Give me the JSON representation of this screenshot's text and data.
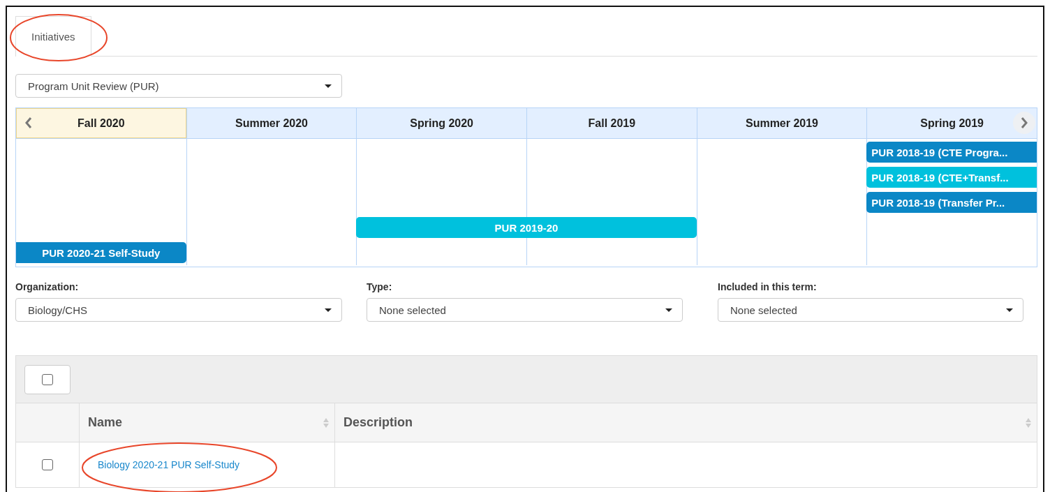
{
  "tabs": [
    {
      "label": "Initiatives",
      "selected": true
    }
  ],
  "program_select": {
    "value": "Program Unit Review (PUR)"
  },
  "timeline": {
    "terms": [
      {
        "label": "Fall 2020",
        "selected": true
      },
      {
        "label": "Summer 2020",
        "selected": false
      },
      {
        "label": "Spring 2020",
        "selected": false
      },
      {
        "label": "Fall 2019",
        "selected": false
      },
      {
        "label": "Summer 2019",
        "selected": false
      },
      {
        "label": "Spring 2019",
        "selected": false
      }
    ],
    "events": [
      {
        "label": "PUR 2020-21 Self-Study",
        "color": "#0b87c6"
      },
      {
        "label": "PUR 2019-20",
        "color": "#00c1dd"
      },
      {
        "label": "PUR 2018-19 (CTE Progra...",
        "color": "#0b87c6"
      },
      {
        "label": "PUR 2018-19 (CTE+Transf...",
        "color": "#00c1dd"
      },
      {
        "label": "PUR 2018-19 (Transfer Pr...",
        "color": "#0b87c6"
      }
    ]
  },
  "filters": [
    {
      "label": "Organization:",
      "value": "Biology/CHS"
    },
    {
      "label": "Type:",
      "value": "None selected"
    },
    {
      "label": "Included in this term:",
      "value": "None selected"
    }
  ],
  "table": {
    "select_all_checked": false,
    "columns": [
      "Name",
      "Description"
    ],
    "rows": [
      {
        "checked": false,
        "name": "Biology 2020-21 PUR Self-Study"
      }
    ]
  }
}
